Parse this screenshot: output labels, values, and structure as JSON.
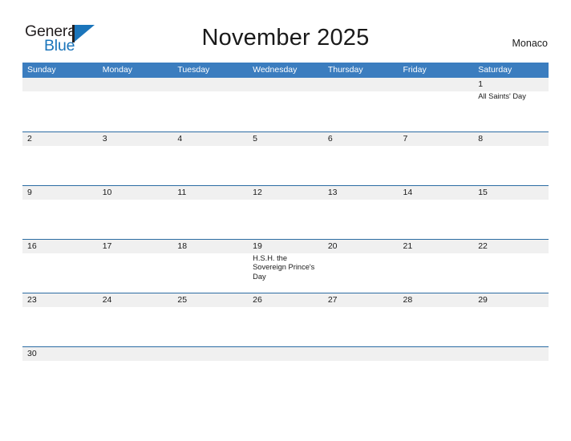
{
  "brand": {
    "name_part1": "General",
    "name_part2": "Blue",
    "mark": "triangle-logo-icon"
  },
  "header": {
    "title": "November 2025",
    "location": "Monaco"
  },
  "calendar": {
    "month": "November",
    "year": "2025",
    "weekdays": [
      "Sunday",
      "Monday",
      "Tuesday",
      "Wednesday",
      "Thursday",
      "Friday",
      "Saturday"
    ],
    "colors": {
      "header_blue": "#3b7dbf",
      "row_border_blue": "#2b6ca3",
      "daynum_band_gray": "#f0f0f0",
      "brand_blue": "#1b75bb",
      "text_dark": "#1a1a1a"
    },
    "weeks": [
      [
        {
          "day": "",
          "events": []
        },
        {
          "day": "",
          "events": []
        },
        {
          "day": "",
          "events": []
        },
        {
          "day": "",
          "events": []
        },
        {
          "day": "",
          "events": []
        },
        {
          "day": "",
          "events": []
        },
        {
          "day": "1",
          "events": [
            "All Saints' Day"
          ]
        }
      ],
      [
        {
          "day": "2",
          "events": []
        },
        {
          "day": "3",
          "events": []
        },
        {
          "day": "4",
          "events": []
        },
        {
          "day": "5",
          "events": []
        },
        {
          "day": "6",
          "events": []
        },
        {
          "day": "7",
          "events": []
        },
        {
          "day": "8",
          "events": []
        }
      ],
      [
        {
          "day": "9",
          "events": []
        },
        {
          "day": "10",
          "events": []
        },
        {
          "day": "11",
          "events": []
        },
        {
          "day": "12",
          "events": []
        },
        {
          "day": "13",
          "events": []
        },
        {
          "day": "14",
          "events": []
        },
        {
          "day": "15",
          "events": []
        }
      ],
      [
        {
          "day": "16",
          "events": []
        },
        {
          "day": "17",
          "events": []
        },
        {
          "day": "18",
          "events": []
        },
        {
          "day": "19",
          "events": [
            "H.S.H. the Sovereign Prince's Day"
          ]
        },
        {
          "day": "20",
          "events": []
        },
        {
          "day": "21",
          "events": []
        },
        {
          "day": "22",
          "events": []
        }
      ],
      [
        {
          "day": "23",
          "events": []
        },
        {
          "day": "24",
          "events": []
        },
        {
          "day": "25",
          "events": []
        },
        {
          "day": "26",
          "events": []
        },
        {
          "day": "27",
          "events": []
        },
        {
          "day": "28",
          "events": []
        },
        {
          "day": "29",
          "events": []
        }
      ],
      [
        {
          "day": "30",
          "events": []
        },
        {
          "day": "",
          "events": []
        },
        {
          "day": "",
          "events": []
        },
        {
          "day": "",
          "events": []
        },
        {
          "day": "",
          "events": []
        },
        {
          "day": "",
          "events": []
        },
        {
          "day": "",
          "events": []
        }
      ]
    ]
  }
}
